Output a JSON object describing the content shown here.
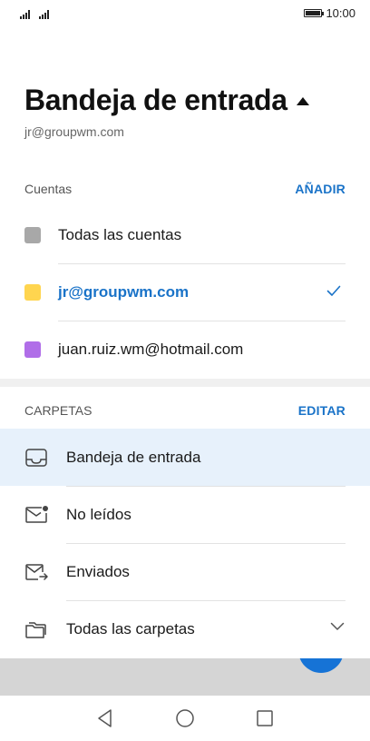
{
  "status_bar": {
    "time": "10:00",
    "battery_level": 1.0
  },
  "header": {
    "title": "Bandeja de entrada",
    "subtitle": "jr@groupwm.com"
  },
  "accounts_section": {
    "label": "Cuentas",
    "action": "AÑADIR",
    "items": [
      {
        "label": "Todas las cuentas",
        "color": "#a8a8a8",
        "selected": false
      },
      {
        "label": "jr@groupwm.com",
        "color": "#ffd54f",
        "selected": true
      },
      {
        "label": "juan.ruiz.wm@hotmail.com",
        "color": "#b06ee8",
        "selected": false
      }
    ]
  },
  "folders_section": {
    "label": "CARPETAS",
    "action": "EDITAR",
    "items": [
      {
        "label": "Bandeja de entrada",
        "icon": "inbox-icon",
        "selected": true
      },
      {
        "label": "No leídos",
        "icon": "unread-mail-icon",
        "selected": false
      },
      {
        "label": "Enviados",
        "icon": "sent-mail-icon",
        "selected": false
      },
      {
        "label": "Todas las carpetas",
        "icon": "folder-icon",
        "selected": false,
        "expandable": true
      }
    ]
  },
  "colors": {
    "accent": "#1a73c8",
    "selected_row": "#e7f1fb",
    "fab": "#1673d6"
  }
}
